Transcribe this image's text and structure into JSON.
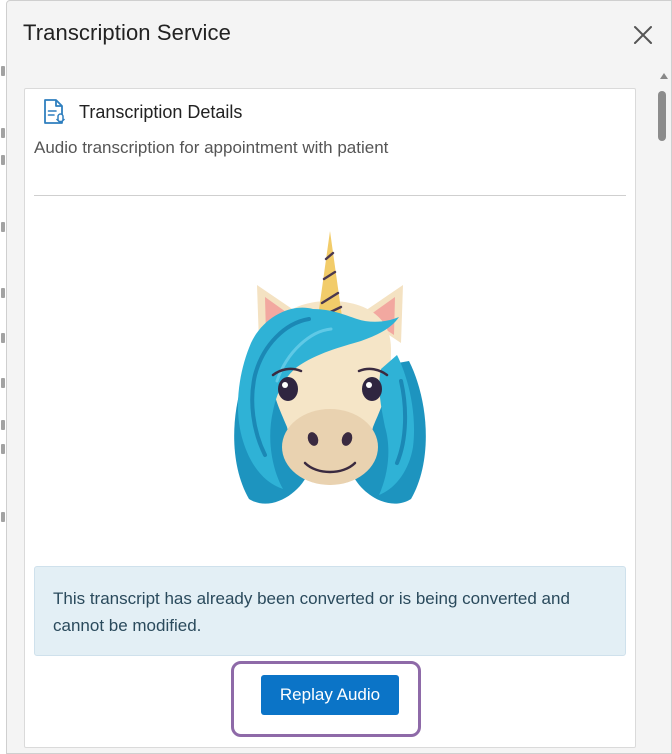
{
  "dialog": {
    "title": "Transcription Service",
    "close_icon": "close-icon"
  },
  "card": {
    "icon": "document-audio-icon",
    "title": "Transcription Details",
    "subtitle": "Audio transcription for appointment with patient",
    "illustration": "unicorn-illustration",
    "notice": "This transcript has already been converted or is being converted and cannot be modified.",
    "replay_button_label": "Replay Audio"
  },
  "colors": {
    "primary_button": "#0b74c7",
    "notice_background": "#e3eff5",
    "highlight_border": "#8e6aa8"
  }
}
